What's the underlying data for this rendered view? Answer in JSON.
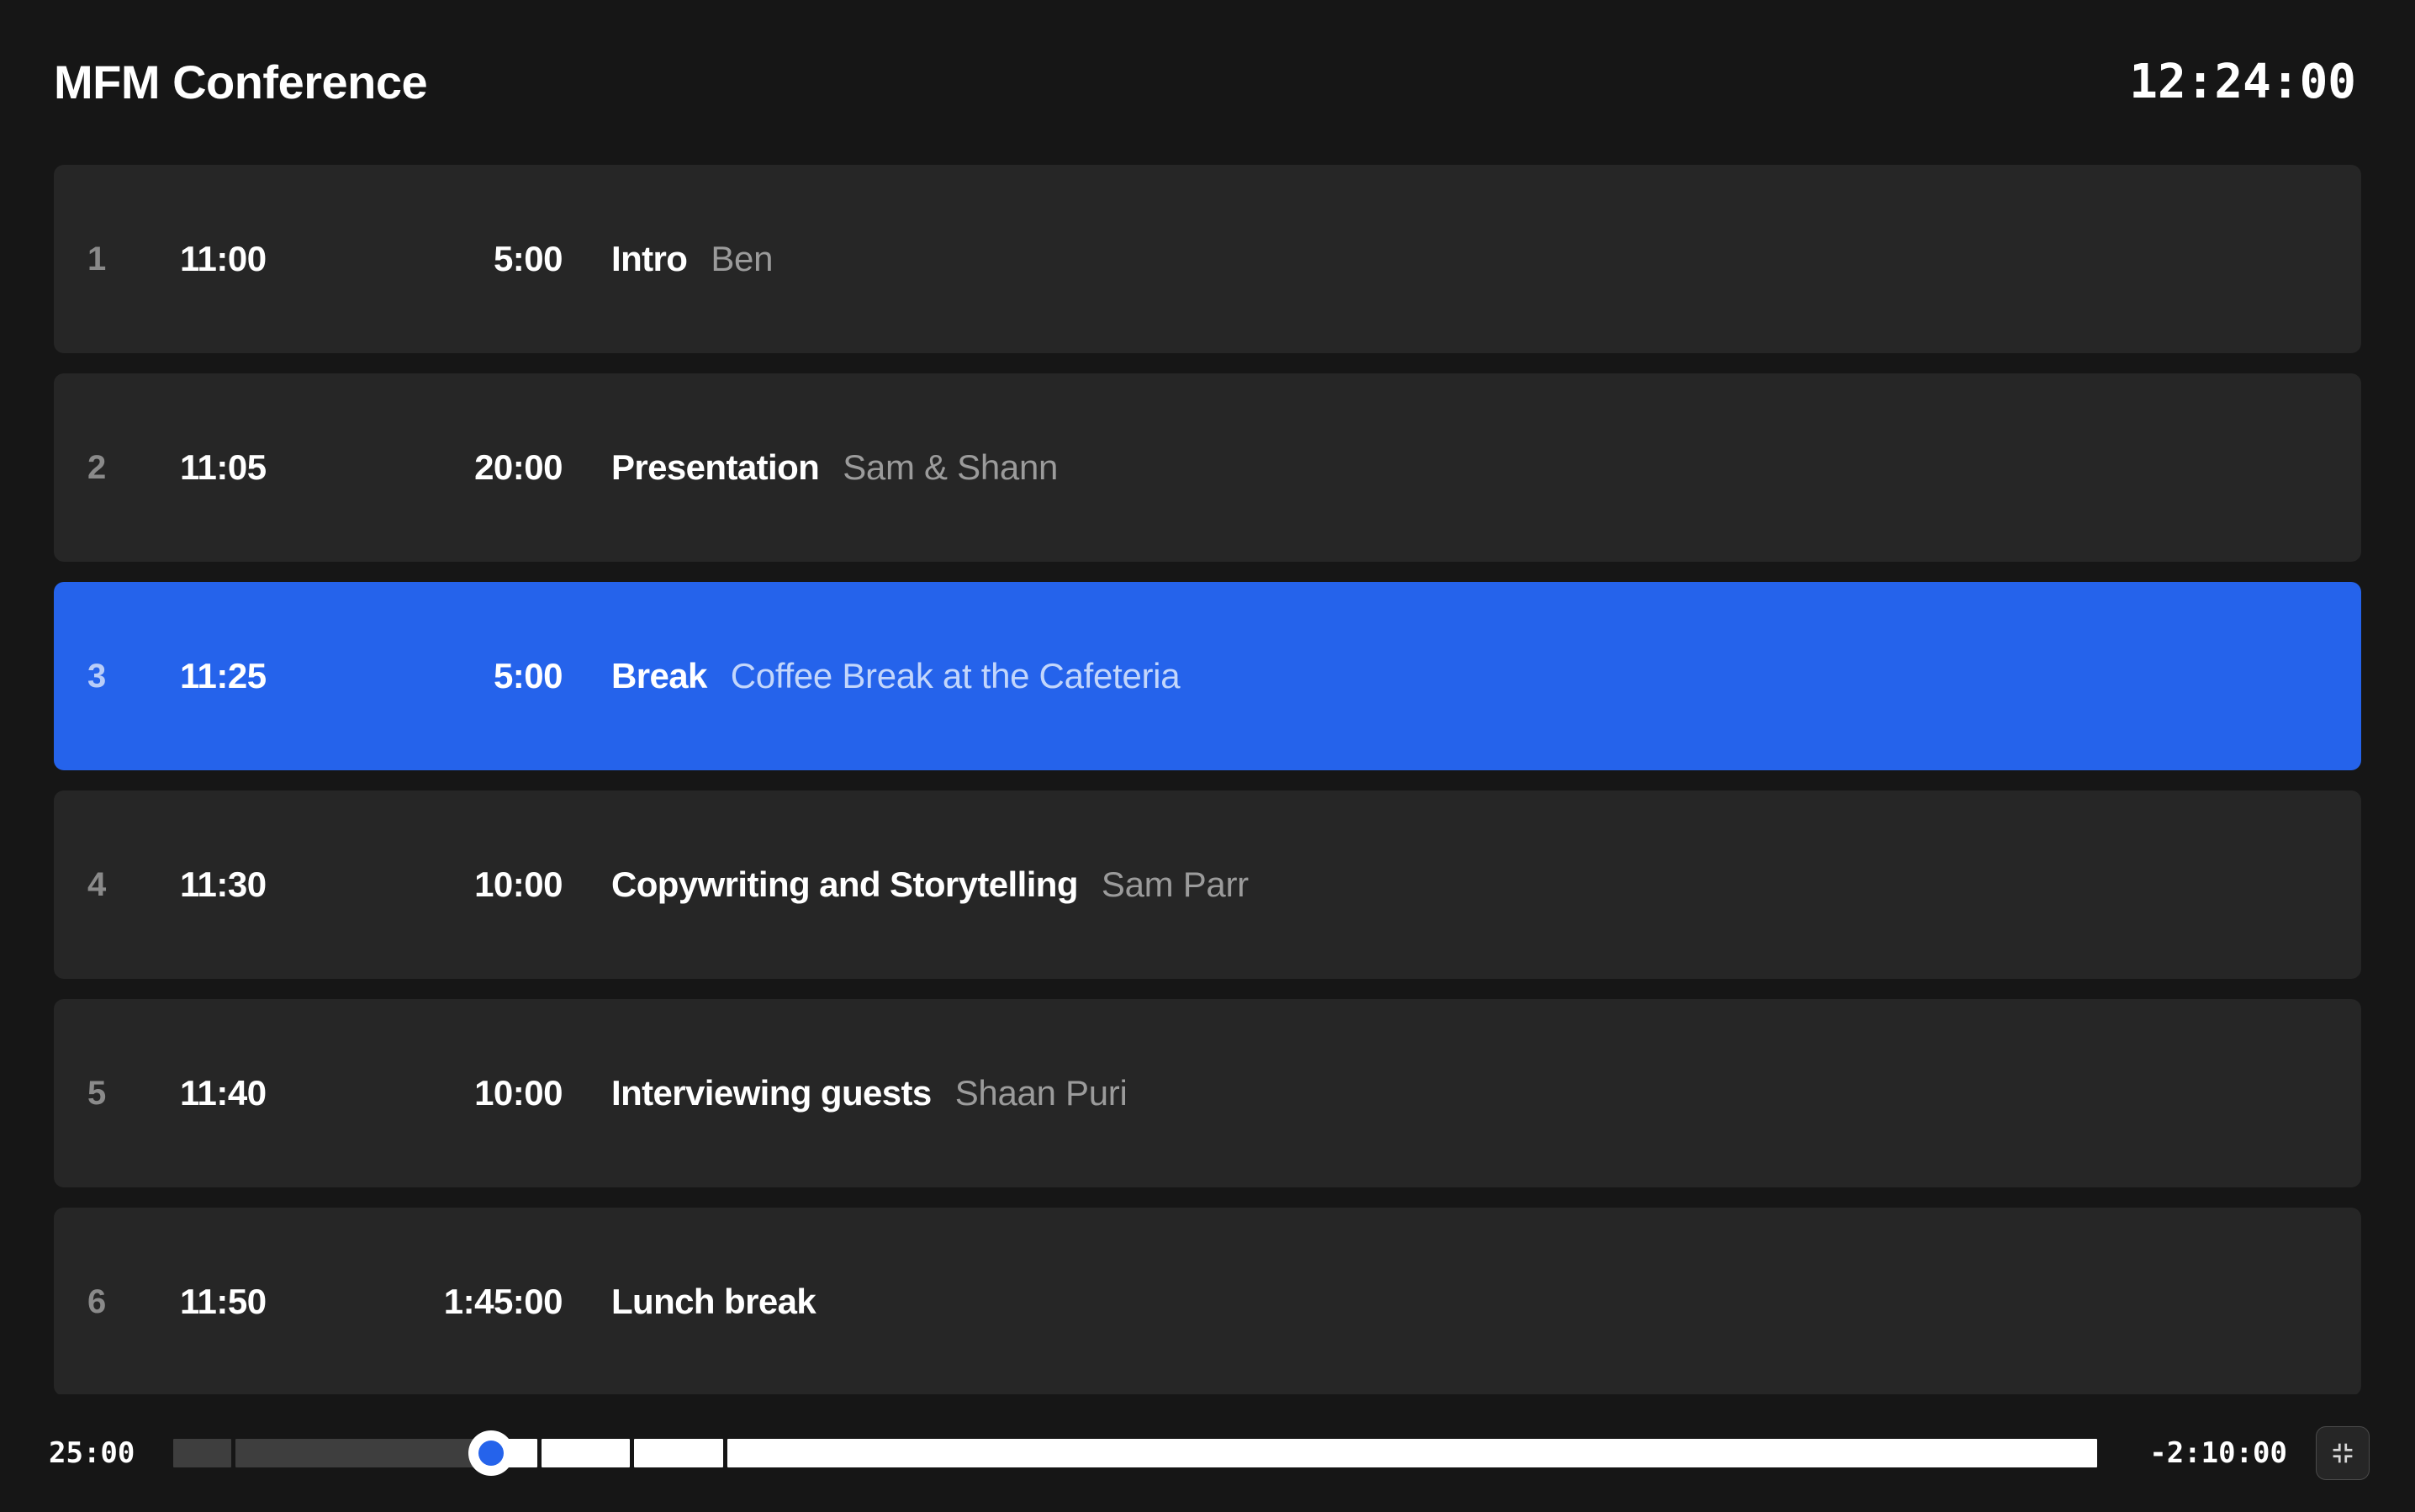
{
  "header": {
    "show_title": "MFM Conference",
    "clock": "12:24:00"
  },
  "rundown": {
    "rows": [
      {
        "index": "1",
        "start": "11:00",
        "duration": "5:00",
        "title": "Intro",
        "speaker": "Ben",
        "active": false
      },
      {
        "index": "2",
        "start": "11:05",
        "duration": "20:00",
        "title": "Presentation",
        "speaker": "Sam & Shann",
        "active": false
      },
      {
        "index": "3",
        "start": "11:25",
        "duration": "5:00",
        "title": "Break",
        "speaker": "Coffee Break at the Cafeteria",
        "active": true
      },
      {
        "index": "4",
        "start": "11:30",
        "duration": "10:00",
        "title": "Copywriting and Storytelling",
        "speaker": "Sam Parr",
        "active": false
      },
      {
        "index": "5",
        "start": "11:40",
        "duration": "10:00",
        "title": "Interviewing guests",
        "speaker": "Shaan Puri",
        "active": false
      },
      {
        "index": "6",
        "start": "11:50",
        "duration": "1:45:00",
        "title": "Lunch break",
        "speaker": "",
        "active": false
      }
    ]
  },
  "transport": {
    "elapsed": "25:00",
    "remaining": "-2:10:00",
    "playhead_percent": 16.5,
    "segments": [
      {
        "width_percent": 3.0,
        "state": "done"
      },
      {
        "width_percent": 12.5,
        "state": "done"
      },
      {
        "width_percent": 3.0,
        "state": "pending"
      },
      {
        "width_percent": 4.6,
        "state": "pending"
      },
      {
        "width_percent": 4.6,
        "state": "pending"
      },
      {
        "width_percent": 71.3,
        "state": "pending"
      }
    ],
    "fullscreen_button": {
      "icon": "exit-fullscreen-icon",
      "label": "Exit fullscreen"
    }
  },
  "colors": {
    "page_background": "#161616",
    "row_background": "#262626",
    "accent_blue": "#2563eb",
    "muted_text": "#9b9b9b",
    "primary_text": "#ffffff"
  }
}
